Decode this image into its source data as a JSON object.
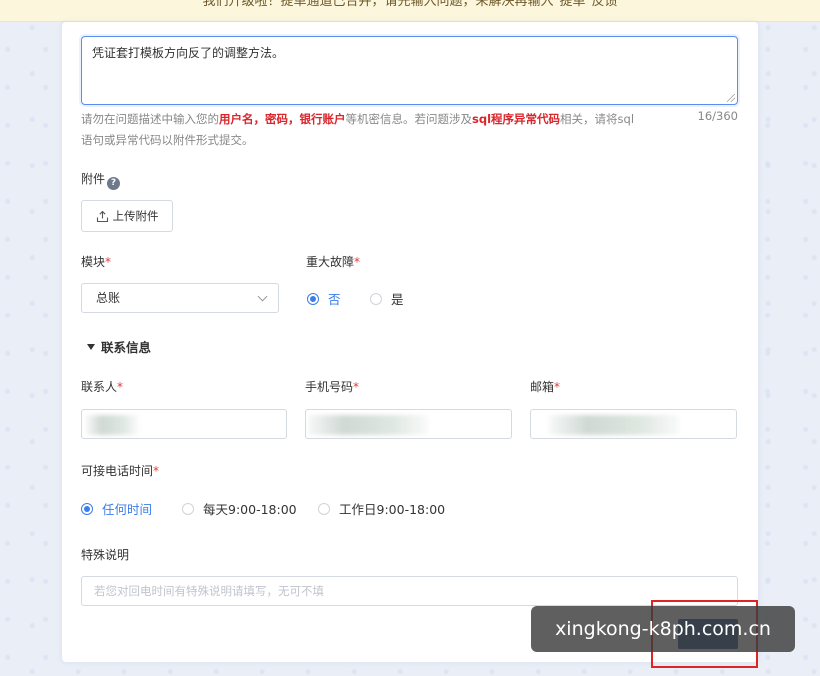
{
  "banner": {
    "text": "我们升级啦！提单通道已合并，请先输入问题，未解决再输入\"提单\"反馈"
  },
  "description": {
    "value": "凭证套打模板方向反了的调整方法。",
    "counter": "16/360",
    "hint_parts": [
      "请勿在问题描述中输入您的",
      "用户名，密码，银行账户",
      "等机密信息。若问题涉及",
      "sql程序异常代码",
      "相关，请将sql语句或异常代码以附件形式提交。"
    ]
  },
  "attachment": {
    "label": "附件",
    "help": "?",
    "upload_label": "上传附件"
  },
  "module": {
    "label": "模块",
    "req": "*",
    "selected": "总账"
  },
  "major_fault": {
    "label": "重大故障",
    "req": "*",
    "options": [
      {
        "label": "否",
        "checked": true
      },
      {
        "label": "是",
        "checked": false
      }
    ]
  },
  "contact_section": {
    "title": "联系信息"
  },
  "contact": {
    "person_label": "联系人",
    "phone_label": "手机号码",
    "email_label": "邮箱",
    "req": "*"
  },
  "call_time": {
    "label": "可接电话时间",
    "req": "*",
    "options": [
      {
        "label": "任何时间",
        "checked": true
      },
      {
        "label": "每天9:00-18:00",
        "checked": false
      },
      {
        "label": "工作日9:00-18:00",
        "checked": false
      }
    ]
  },
  "special_note": {
    "label": "特殊说明",
    "placeholder": "若您对回电时间有特殊说明请填写，无可不填"
  },
  "watermark": {
    "text": "xingkong-k8ph.com.cn"
  },
  "colors": {
    "accent": "#3b7ded",
    "required": "#e03a3a",
    "warning_red": "#d9262c",
    "submit": "#1f4e8c",
    "frame": "#e02424"
  }
}
